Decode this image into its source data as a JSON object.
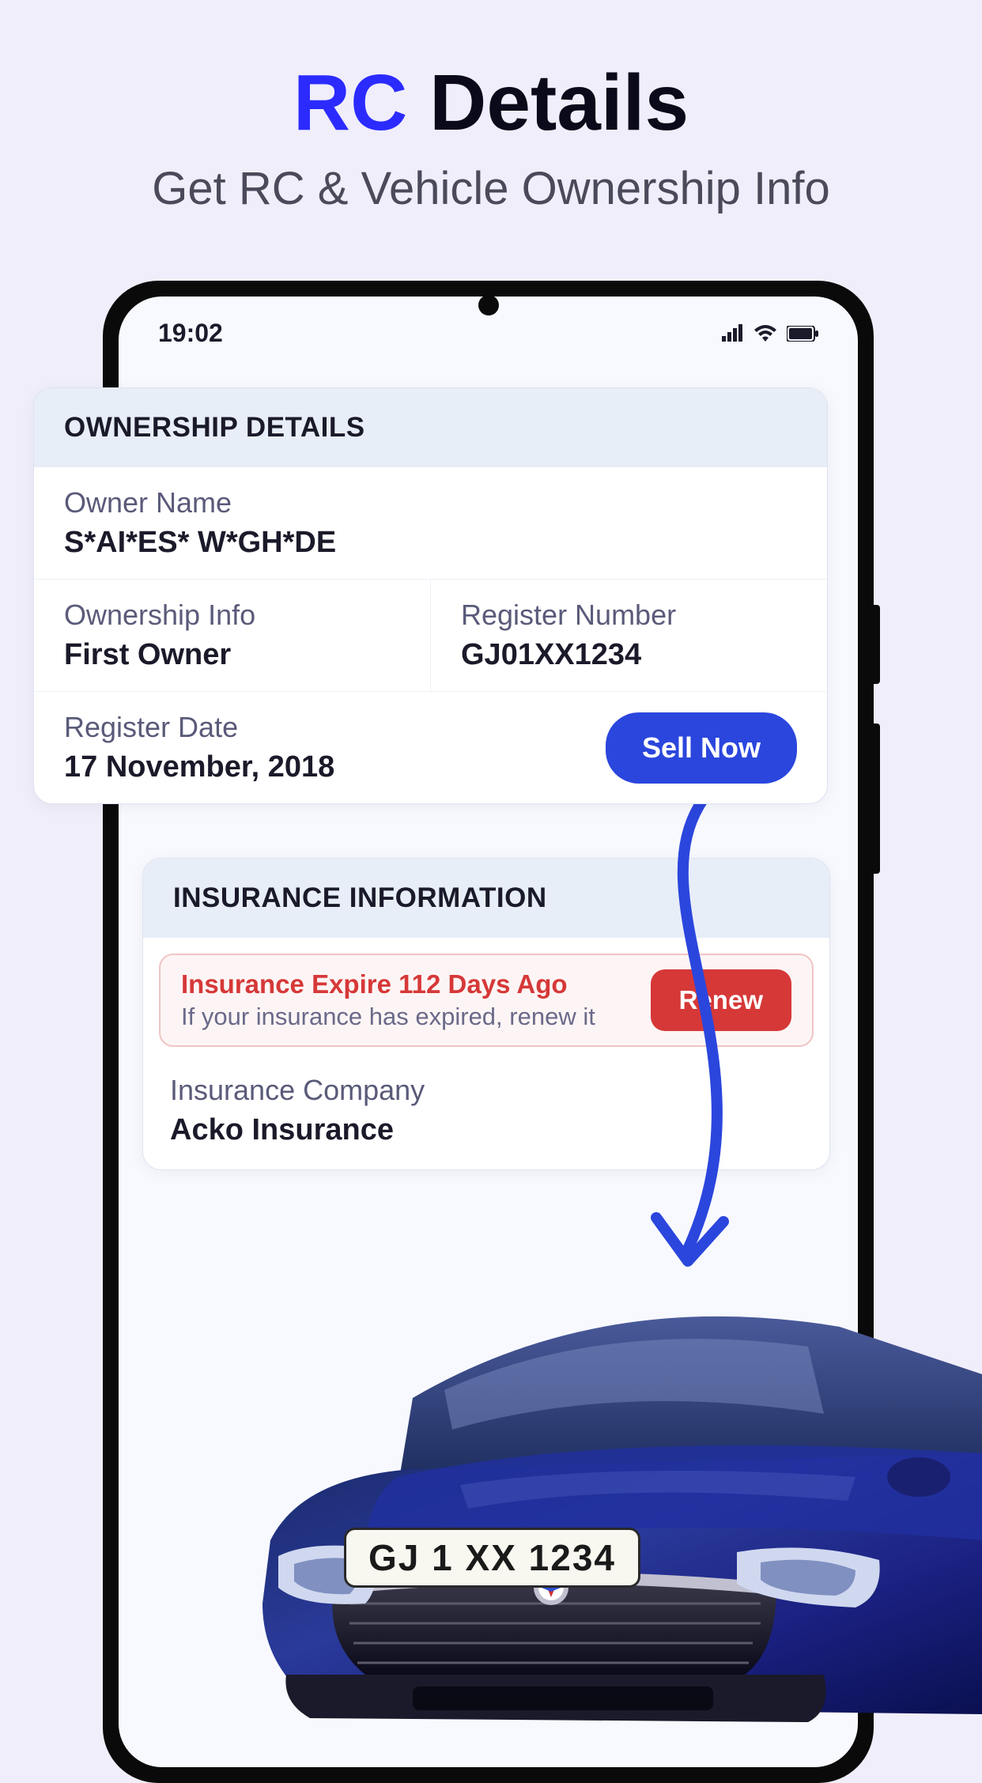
{
  "header": {
    "title_highlight": "RC",
    "title_rest": " Details",
    "subtitle": "Get RC & Vehicle Ownership Info"
  },
  "status": {
    "time": "19:02"
  },
  "ownership": {
    "card_title": "OWNERSHIP DETAILS",
    "owner_name_label": "Owner Name",
    "owner_name_value": "S*AI*ES* W*GH*DE",
    "ownership_info_label": "Ownership Info",
    "ownership_info_value": "First Owner",
    "register_number_label": "Register Number",
    "register_number_value": "GJ01XX1234",
    "register_date_label": "Register Date",
    "register_date_value": "17 November, 2018",
    "sell_button": "Sell Now"
  },
  "insurance": {
    "card_title": "INSURANCE INFORMATION",
    "expire_title": "Insurance Expire 112 Days Ago",
    "expire_sub": "If your insurance has expired, renew it",
    "renew_button": "Renew",
    "company_label": "Insurance Company",
    "company_value": "Acko Insurance"
  },
  "vehicle": {
    "license_plate": "GJ 1 XX 1234"
  }
}
